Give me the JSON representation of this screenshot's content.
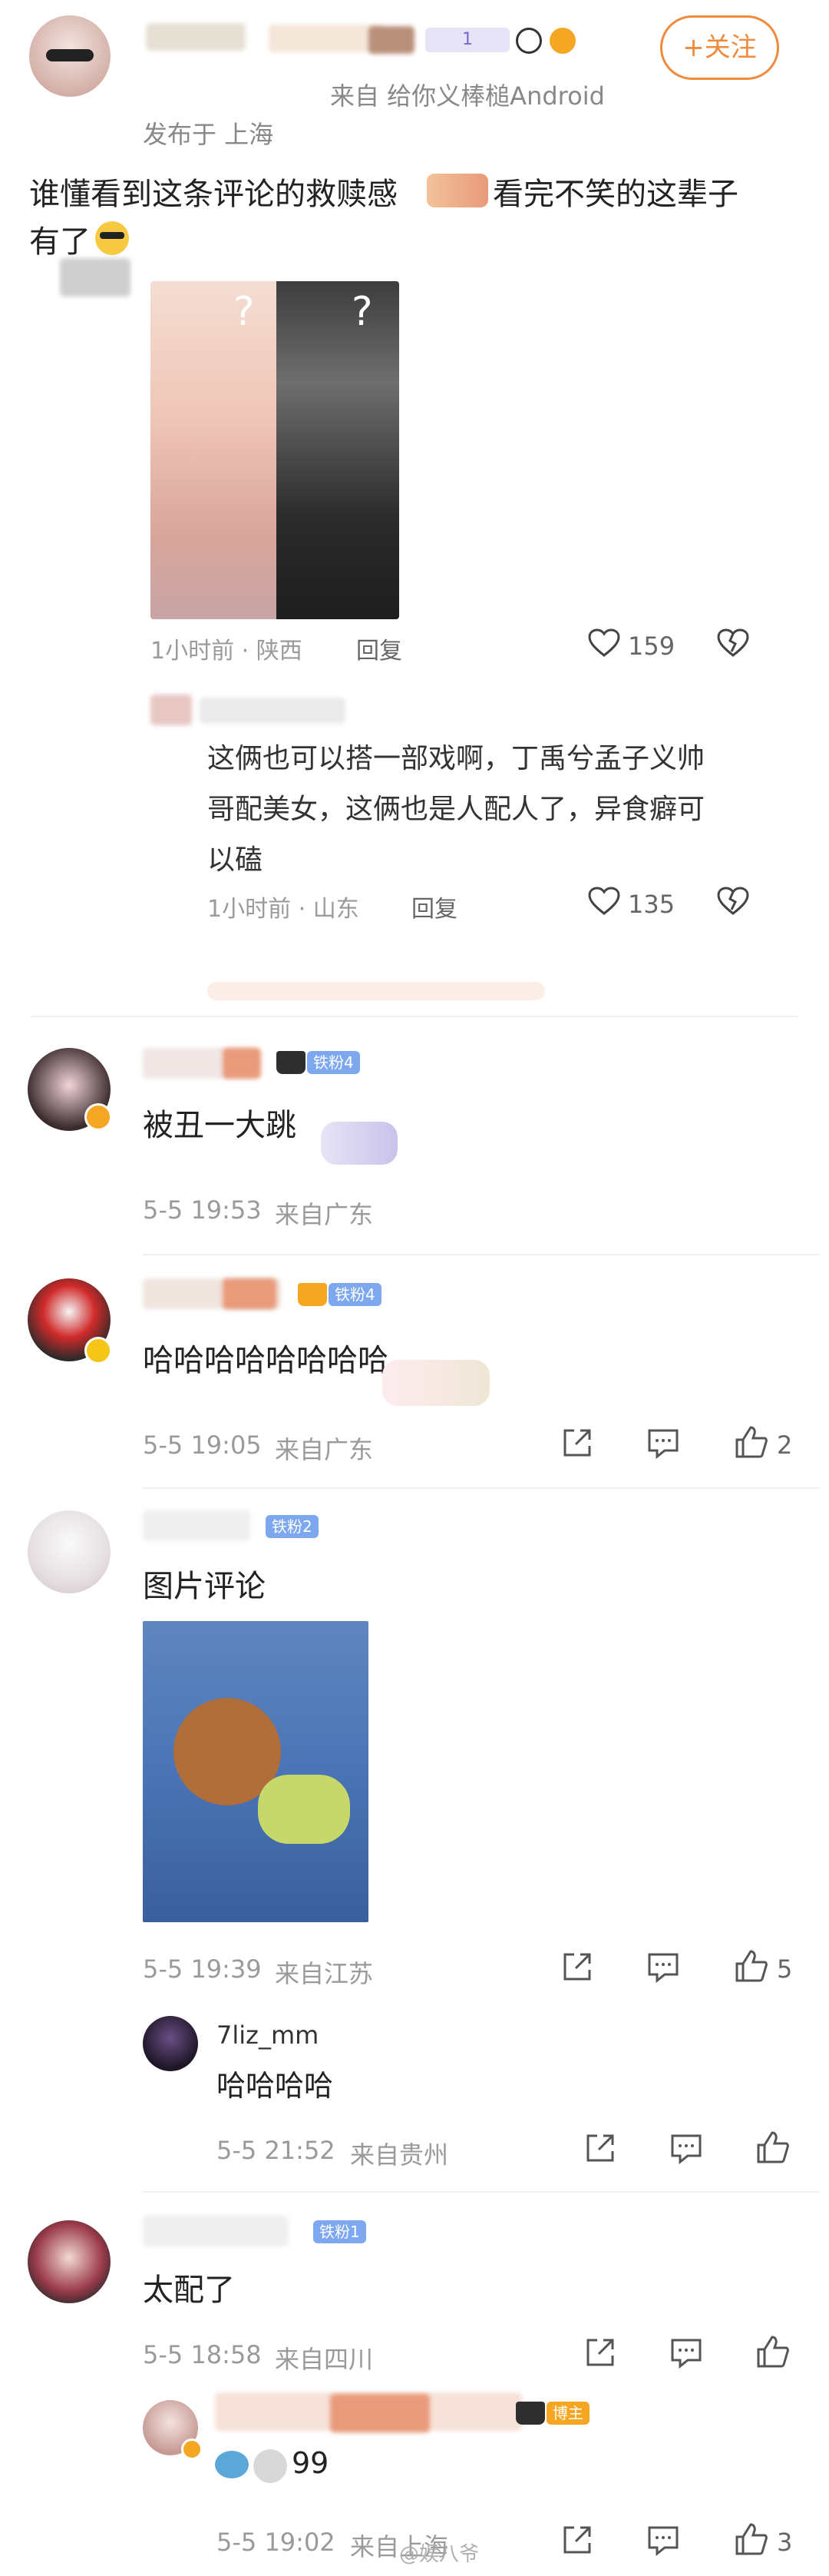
{
  "post": {
    "follow_label": "+关注",
    "source": "来自 给你义棒槌Android",
    "published": "发布于 上海",
    "text_line1": "谁懂看到这条评论的救赎感",
    "text_line1b": "看完不笑的这辈子",
    "text_line2": "有了",
    "level_badge": "1"
  },
  "quoted": {
    "meta": "1小时前 · 陕西",
    "reply": "回复",
    "likes": "159",
    "reply_text_1": "这俩也可以搭一部戏啊，丁禹兮孟子义帅",
    "reply_text_2": "哥配美女，这俩也是人配人了，异食癖可",
    "reply_text_3": "以磕",
    "reply_meta": "1小时前 · 山东",
    "reply_reply": "回复",
    "reply_likes": "135"
  },
  "comments": [
    {
      "badge": "铁粉4",
      "text": "被丑一大跳",
      "time": "5-5 19:53",
      "loc": "来自广东"
    },
    {
      "badge": "铁粉4",
      "text": "哈哈哈哈哈哈哈哈",
      "time": "5-5 19:05",
      "loc": "来自广东",
      "likes": "2"
    },
    {
      "badge": "铁粉2",
      "text": "图片评论",
      "time": "5-5 19:39",
      "loc": "来自江苏",
      "likes": "5"
    },
    {
      "user": "7liz_mm",
      "text": "哈哈哈哈",
      "time": "5-5 21:52",
      "loc": "来自贵州"
    },
    {
      "badge": "铁粉1",
      "text": "太配了",
      "time": "5-5 18:58",
      "loc": "来自四川"
    },
    {
      "badge": "博主",
      "text": "99",
      "time": "5-5 19:02",
      "loc": "来自上海",
      "likes": "3"
    }
  ],
  "watermark": "@娱八爷"
}
